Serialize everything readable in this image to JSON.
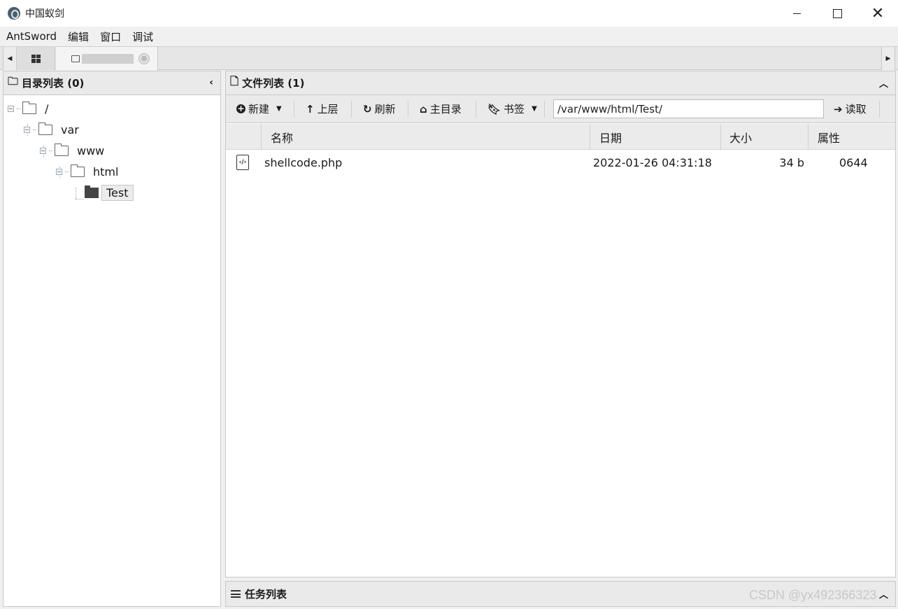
{
  "window": {
    "title": "中国蚁剑"
  },
  "menu": [
    "AntSword",
    "编辑",
    "窗口",
    "调试"
  ],
  "tabs": {
    "home_icon": "grid-icon",
    "file_tab_icon": "folder-icon",
    "close_glyph": "⊗"
  },
  "dir_panel": {
    "title": "目录列表 (0)"
  },
  "tree": [
    {
      "label": "/",
      "depth": 0
    },
    {
      "label": "var",
      "depth": 1
    },
    {
      "label": "www",
      "depth": 2
    },
    {
      "label": "html",
      "depth": 3
    },
    {
      "label": "Test",
      "depth": 4,
      "selected": true
    }
  ],
  "file_panel": {
    "title": "文件列表 (1)"
  },
  "toolbar": {
    "new_label": "新建",
    "up_label": "上层",
    "refresh_label": "刷新",
    "home_label": "主目录",
    "bookmark_label": "书签",
    "path_value": "/var/www/html/Test/",
    "read_label": "读取"
  },
  "grid": {
    "columns": [
      "名称",
      "日期",
      "大小",
      "属性"
    ],
    "rows": [
      {
        "name": "shellcode.php",
        "date": "2022-01-26 04:31:18",
        "size": "34 b",
        "attr": "0644"
      }
    ]
  },
  "task_panel": {
    "title": "任务列表"
  },
  "watermark": "CSDN @yx492366323"
}
